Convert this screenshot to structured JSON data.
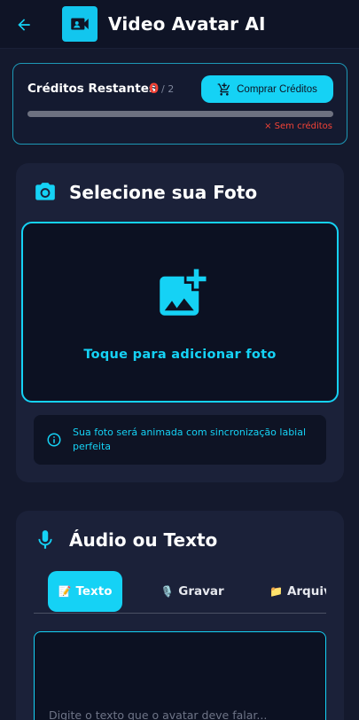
{
  "header": {
    "title": "Video Avatar AI",
    "back_icon": "arrow-left-icon",
    "logo_icon": "videocam-icon"
  },
  "credits": {
    "label": "Créditos Restantes",
    "remaining": "0",
    "total": "/ 2",
    "progress_fraction": 0,
    "buy_label": "Comprar Créditos",
    "status": "× Sem créditos"
  },
  "photo": {
    "title": "Selecione sua Foto",
    "dropzone_label": "Toque para adicionar foto",
    "info": "Sua foto será animada com sincronização labial perfeita"
  },
  "audio": {
    "title": "Áudio ou Texto",
    "tabs": [
      {
        "emoji": "📝",
        "label": "Texto",
        "active": true
      },
      {
        "emoji": "🎙️",
        "label": "Gravar",
        "active": false
      },
      {
        "emoji": "📁",
        "label": "Arquivo",
        "active": false
      }
    ],
    "text_placeholder": "Digite o texto que o avatar deve falar..."
  },
  "colors": {
    "accent": "#15d2f5",
    "background": "#14192d",
    "card": "#1b2139",
    "danger": "#f44336"
  }
}
